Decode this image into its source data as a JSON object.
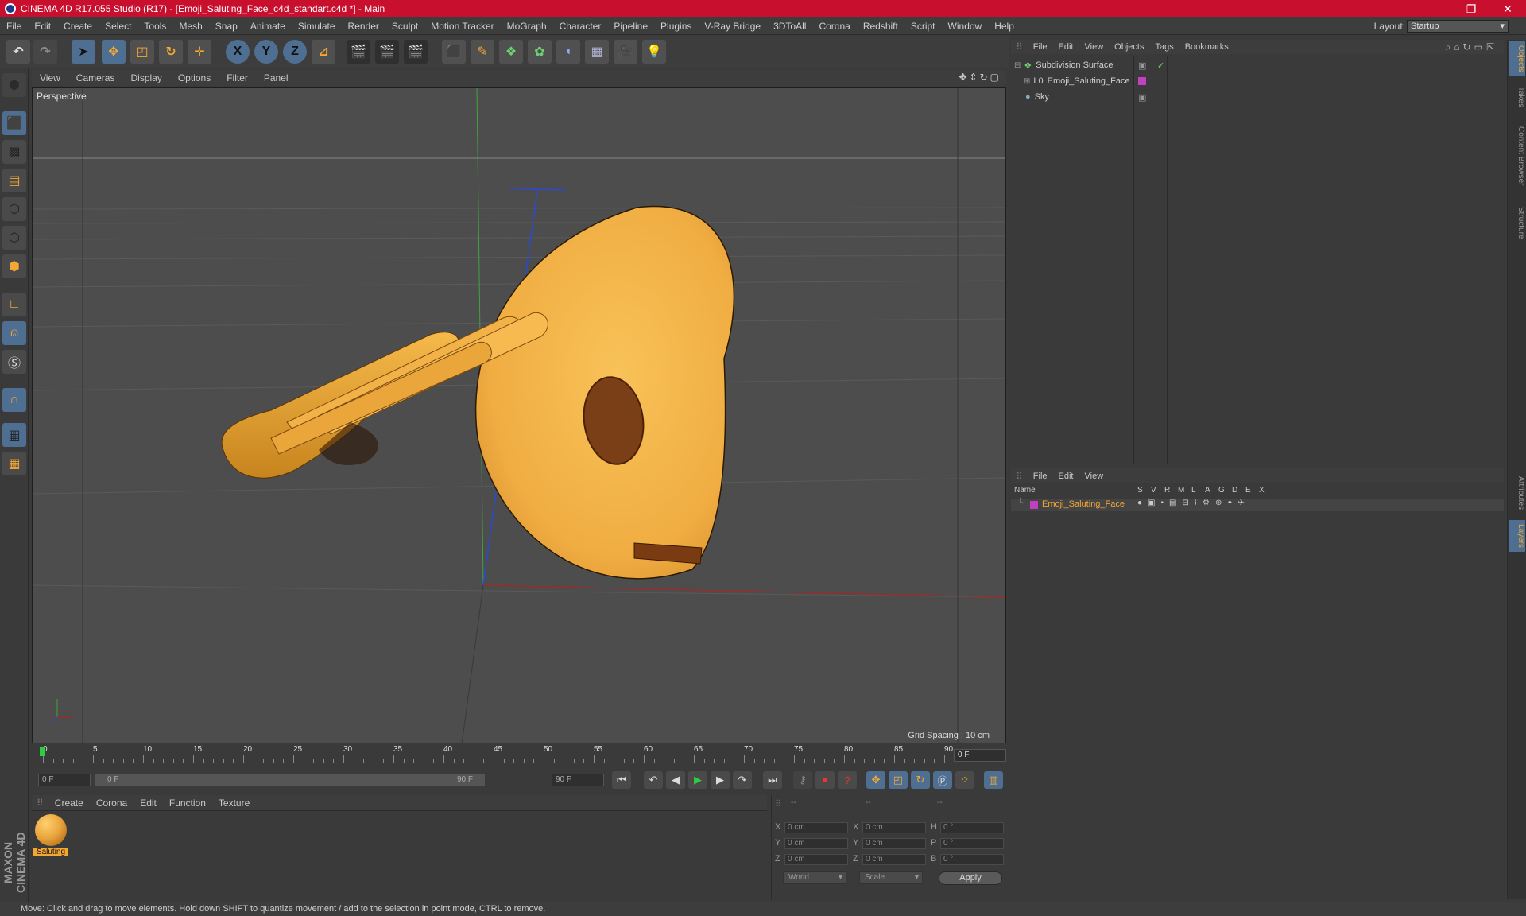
{
  "titlebar": {
    "title": "CINEMA 4D R17.055 Studio (R17) - [Emoji_Saluting_Face_c4d_standart.c4d *] - Main",
    "minimize": "–",
    "maximize": "❐",
    "close": "✕"
  },
  "menubar": {
    "items": [
      "File",
      "Edit",
      "Create",
      "Select",
      "Tools",
      "Mesh",
      "Snap",
      "Animate",
      "Simulate",
      "Render",
      "Sculpt",
      "Motion Tracker",
      "MoGraph",
      "Character",
      "Pipeline",
      "Plugins",
      "V-Ray Bridge",
      "3DToAll",
      "Corona",
      "Redshift",
      "Script",
      "Window",
      "Help"
    ],
    "layout_label": "Layout:",
    "layout_value": "Startup"
  },
  "toolbar": {
    "x_label": "X",
    "y_label": "Y",
    "z_label": "Z"
  },
  "viewport": {
    "menu": [
      "View",
      "Cameras",
      "Display",
      "Options",
      "Filter",
      "Panel"
    ],
    "label": "Perspective",
    "grid_spacing": "Grid Spacing : 10 cm"
  },
  "timeline": {
    "ticks": [
      "0",
      "5",
      "10",
      "15",
      "20",
      "25",
      "30",
      "35",
      "40",
      "45",
      "50",
      "55",
      "60",
      "65",
      "70",
      "75",
      "80",
      "85",
      "90"
    ],
    "current_frame": "0 F",
    "start_field": "0 F",
    "range_start": "0 F",
    "range_end": "90 F",
    "end_field": "90 F"
  },
  "material_manager": {
    "menu": [
      "Create",
      "Corona",
      "Edit",
      "Function",
      "Texture"
    ],
    "material_name": "Saluting"
  },
  "maxon": {
    "logo": "MAXON CINEMA 4D"
  },
  "coordinates": {
    "headers": [
      "--",
      "--",
      "--"
    ],
    "rows": [
      {
        "axis": "X",
        "pos": "0 cm",
        "axis2": "X",
        "size": "0 cm",
        "rot_axis": "H",
        "rot": "0 °"
      },
      {
        "axis": "Y",
        "pos": "0 cm",
        "axis2": "Y",
        "size": "0 cm",
        "rot_axis": "P",
        "rot": "0 °"
      },
      {
        "axis": "Z",
        "pos": "0 cm",
        "axis2": "Z",
        "size": "0 cm",
        "rot_axis": "B",
        "rot": "0 °"
      }
    ],
    "mode_world": "World",
    "mode_scale": "Scale",
    "apply": "Apply"
  },
  "object_manager": {
    "menu": [
      "File",
      "Edit",
      "View",
      "Objects",
      "Tags",
      "Bookmarks"
    ],
    "objects": [
      {
        "name": "Subdivision Surface"
      },
      {
        "name": "Emoji_Saluting_Face"
      },
      {
        "name": "Sky"
      }
    ]
  },
  "layer_manager": {
    "menu": [
      "File",
      "Edit",
      "View"
    ],
    "columns": [
      "Name",
      "S",
      "V",
      "R",
      "M",
      "L",
      "A",
      "G",
      "D",
      "E",
      "X"
    ],
    "layers": [
      {
        "name": "Emoji_Saluting_Face"
      }
    ]
  },
  "side_tabs": [
    "Objects",
    "Takes",
    "Content Browser",
    "Structure"
  ],
  "side_tabs_lower": [
    "Attributes",
    "Layers"
  ],
  "statusbar": {
    "text": "Move: Click and drag to move elements. Hold down SHIFT to quantize movement / add to the selection in point mode, CTRL to remove."
  },
  "colors": {
    "title_bar": "#c8102e",
    "accent_blue": "#4f6f92",
    "material_orange": "#f4a732",
    "emoji_face": "#f2b54b",
    "layer_magenta": "#c040c0"
  }
}
